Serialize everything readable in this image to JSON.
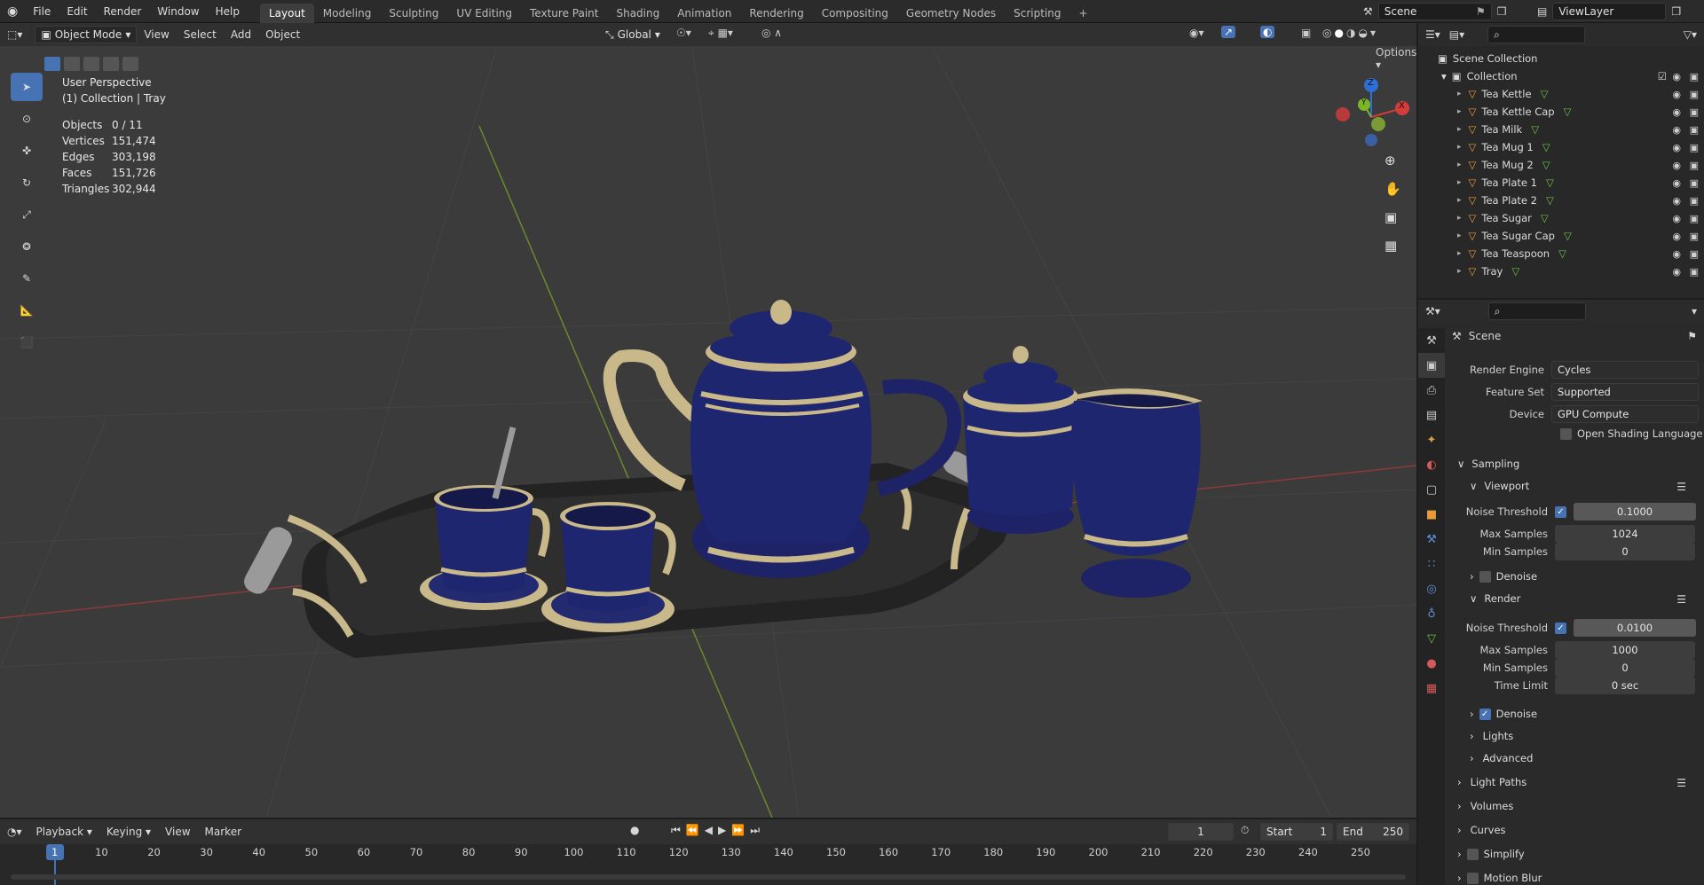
{
  "menu": [
    "File",
    "Edit",
    "Render",
    "Window",
    "Help"
  ],
  "workspaces": [
    "Layout",
    "Modeling",
    "Sculpting",
    "UV Editing",
    "Texture Paint",
    "Shading",
    "Animation",
    "Rendering",
    "Compositing",
    "Geometry Nodes",
    "Scripting"
  ],
  "active_workspace": "Layout",
  "add_workspace": "+",
  "scene_name": "Scene",
  "view_layer": "ViewLayer",
  "viewport_header": {
    "mode": "Object Mode",
    "menus": [
      "View",
      "Select",
      "Add",
      "Object"
    ],
    "orientation": "Global",
    "options": "Options"
  },
  "overlay_info": {
    "line1": "User Perspective",
    "line2": "(1) Collection | Tray"
  },
  "stats": [
    {
      "label": "Objects",
      "value": "0 / 11"
    },
    {
      "label": "Vertices",
      "value": "151,474"
    },
    {
      "label": "Edges",
      "value": "303,198"
    },
    {
      "label": "Faces",
      "value": "151,726"
    },
    {
      "label": "Triangles",
      "value": "302,944"
    }
  ],
  "gizmo": {
    "x": "X",
    "y": "Y",
    "z": "Z"
  },
  "outliner": {
    "root": "Scene Collection",
    "collection": "Collection",
    "items": [
      "Tea Kettle",
      "Tea Kettle Cap",
      "Tea Milk",
      "Tea Mug 1",
      "Tea Mug 2",
      "Tea Plate 1",
      "Tea Plate 2",
      "Tea Sugar",
      "Tea Sugar Cap",
      "Tea Teaspoon",
      "Tray"
    ]
  },
  "properties": {
    "context": "Scene",
    "render_engine_label": "Render Engine",
    "render_engine": "Cycles",
    "feature_set_label": "Feature Set",
    "feature_set": "Supported",
    "device_label": "Device",
    "device": "GPU Compute",
    "osl_label": "Open Shading Language",
    "sampling": "Sampling",
    "viewport": "Viewport",
    "noise_threshold_label": "Noise Threshold",
    "vp_noise_threshold": "0.1000",
    "max_samples_label": "Max Samples",
    "vp_max_samples": "1024",
    "min_samples_label": "Min Samples",
    "vp_min_samples": "0",
    "denoise_label": "Denoise",
    "render": "Render",
    "r_noise_threshold": "0.0100",
    "r_max_samples": "1000",
    "r_min_samples": "0",
    "time_limit_label": "Time Limit",
    "r_time_limit": "0 sec",
    "lights": "Lights",
    "advanced": "Advanced",
    "light_paths": "Light Paths",
    "volumes": "Volumes",
    "curves": "Curves",
    "simplify": "Simplify",
    "motion_blur": "Motion Blur"
  },
  "timeline": {
    "menus": [
      "Playback",
      "Keying",
      "View",
      "Marker"
    ],
    "current_frame": "1",
    "start_label": "Start",
    "start": "1",
    "end_label": "End",
    "end": "250",
    "ticks": [
      "1",
      "10",
      "20",
      "30",
      "40",
      "50",
      "60",
      "70",
      "80",
      "90",
      "100",
      "110",
      "120",
      "130",
      "140",
      "150",
      "160",
      "170",
      "180",
      "190",
      "200",
      "210",
      "220",
      "230",
      "240",
      "250"
    ]
  },
  "colors": {
    "accent": "#4772b3",
    "navy": "#1d2366",
    "gold": "#c8b88a"
  }
}
